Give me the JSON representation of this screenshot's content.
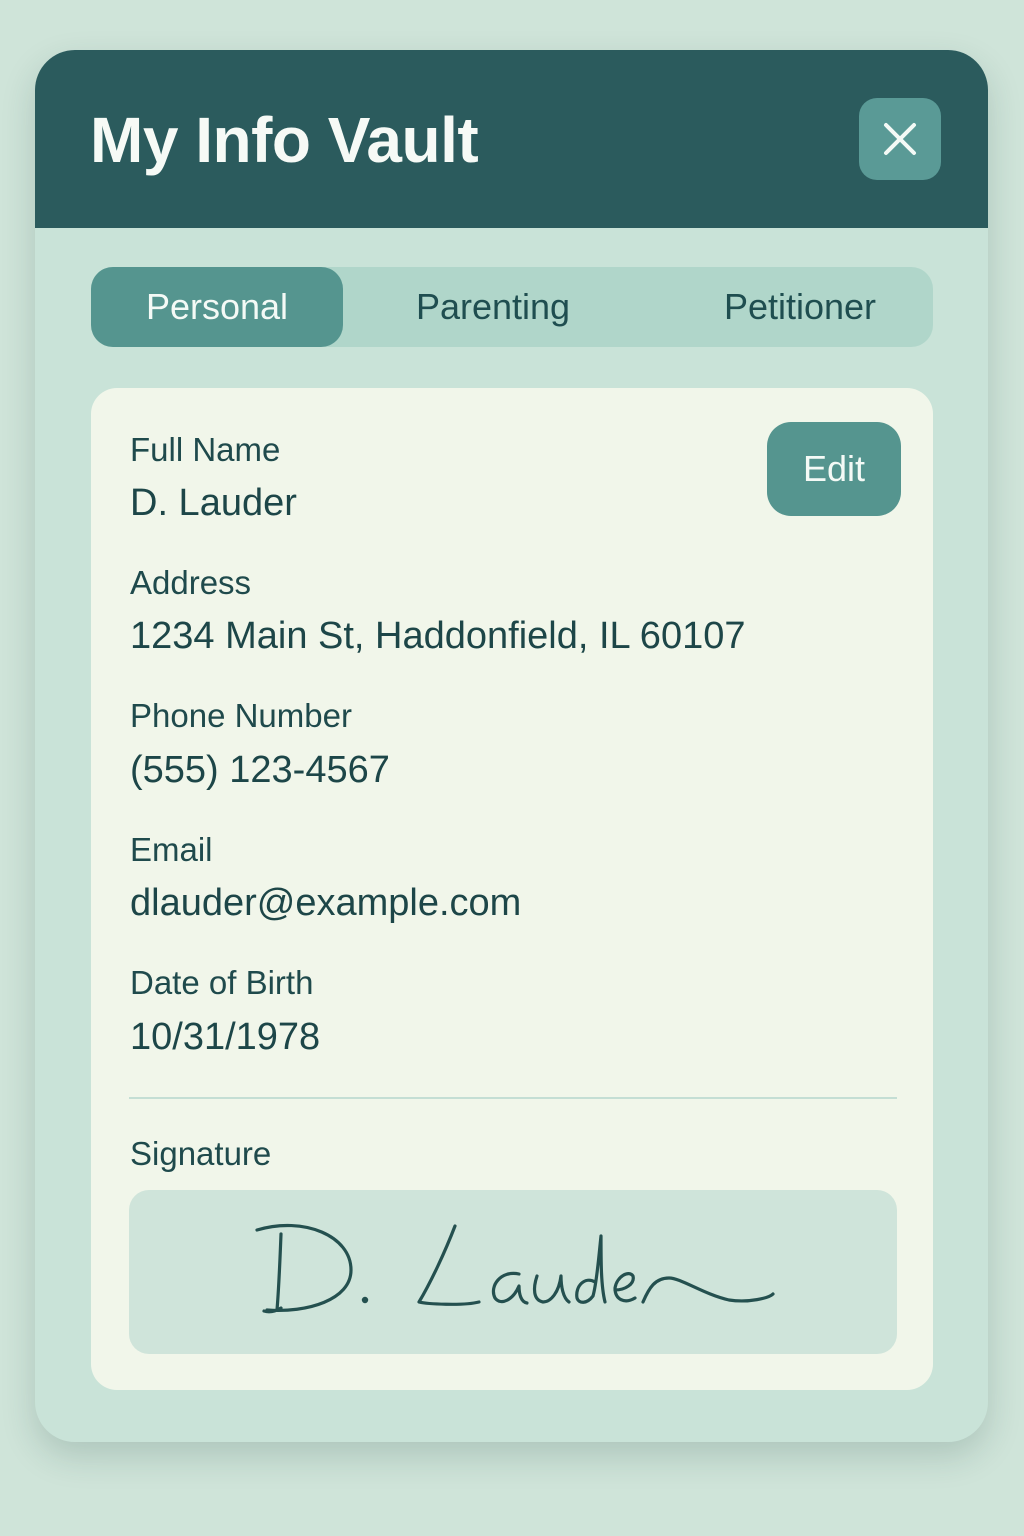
{
  "header": {
    "title": "My Info Vault",
    "close_icon": "close-icon"
  },
  "tabs": [
    {
      "label": "Personal",
      "active": true
    },
    {
      "label": "Parenting",
      "active": false
    },
    {
      "label": "Petitioner",
      "active": false
    }
  ],
  "card": {
    "edit_label": "Edit",
    "fields": [
      {
        "label": "Full Name",
        "value": "D. Lauder"
      },
      {
        "label": "Address",
        "value": "1234 Main St, Haddonfield, IL 60107"
      },
      {
        "label": "Phone Number",
        "value": "(555) 123-4567"
      },
      {
        "label": "Email",
        "value": "dlauder@example.com"
      },
      {
        "label": "Date of Birth",
        "value": "10/31/1978"
      }
    ],
    "signature": {
      "label": "Signature",
      "text": "D. Lauder"
    }
  },
  "colors": {
    "header": "#2b5b5d",
    "accent": "#55958f",
    "background": "#cfe4d9",
    "card": "#f1f6ea"
  }
}
